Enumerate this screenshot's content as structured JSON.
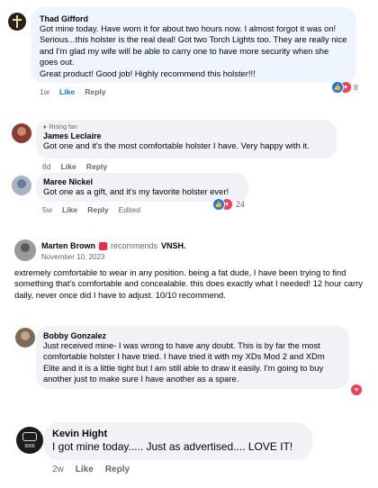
{
  "comments": [
    {
      "author": "Thad Gifford",
      "text": "Got mine today. Have worn it for about two hours now. I almost forgot it was on! Serious...this holster is the real deal! Got two Torch Lights too. They are really nice and I'm glad my wife will be able to carry one to have more security when she goes out.\nGreat product! Good job! Highly recommend this holster!!!",
      "time": "1w",
      "like": "Like",
      "reply": "Reply",
      "reaction_count": "8"
    },
    {
      "badge": "Rising fan",
      "author": "James Leclaire",
      "text": "Got one and it's the most comfortable holster I have. Very happy with it.",
      "time": "8d",
      "like": "Like",
      "reply": "Reply"
    },
    {
      "author": "Maree Nickel",
      "text": "Got one as a gift, and it's my favorite holster ever!",
      "time": "5w",
      "like": "Like",
      "reply": "Reply",
      "edited": "Edited",
      "reaction_count": "24"
    },
    {
      "author": "Marten Brown",
      "recommends_prefix": "recommends",
      "page": "VNSH.",
      "date": "November 10, 2023",
      "text": "extremely comfortable to wear in any position.  being a fat dude, I have been trying to find something that's comfortable and concealable. this does exactly what I needed! 12 hour carry daily, never once did I have to adjust.  10/10 recommend."
    },
    {
      "author": "Bobby Gonzalez",
      "text": "Just received mine- I was wrong to have any doubt. This is by far the most comfortable holster I have tried. I have tried it with my XDs Mod 2 and XDm Elite and it is a little tight but I am still able to draw it easily. I'm going to buy another just to make sure I have another as a spare."
    },
    {
      "author": "Kevin Hight",
      "avatar_text": "5000",
      "text": "I got mine today..... Just as advertised.... LOVE IT!",
      "time": "2w",
      "like": "Like",
      "reply": "Reply"
    }
  ],
  "colors": {
    "like": "#1877f2",
    "love": "#f33e58",
    "bubble": "#f0f2f5",
    "meta": "#65676b"
  }
}
